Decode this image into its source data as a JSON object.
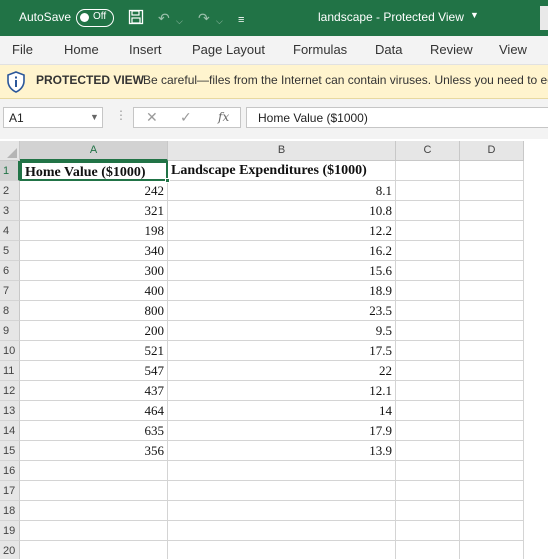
{
  "titlebar": {
    "autosave_label": "AutoSave",
    "autosave_state": "Off",
    "title": "landscape  -  Protected View",
    "colors": {
      "background": "#217346",
      "text": "#ffffff"
    }
  },
  "ribbon": {
    "tabs": [
      {
        "label": "File"
      },
      {
        "label": "Home"
      },
      {
        "label": "Insert"
      },
      {
        "label": "Page Layout"
      },
      {
        "label": "Formulas"
      },
      {
        "label": "Data"
      },
      {
        "label": "Review"
      },
      {
        "label": "View"
      }
    ]
  },
  "protected_view": {
    "label": "PROTECTED VIEW",
    "message": "Be careful—files from the Internet can contain viruses. Unless you need to ed",
    "icon": "shield-info-icon",
    "colors": {
      "background": "#fff4ce",
      "accent": "#2b579a"
    }
  },
  "formula_bar": {
    "name_box": "A1",
    "fx_label": "fx",
    "content": "Home Value ($1000)"
  },
  "grid": {
    "columns": [
      "A",
      "B",
      "C",
      "D"
    ],
    "selected_column": "A",
    "rows": [
      "1",
      "2",
      "3",
      "4",
      "5",
      "6",
      "7",
      "8",
      "9",
      "10",
      "11",
      "12",
      "13",
      "14",
      "15",
      "16",
      "17",
      "18",
      "19",
      "20"
    ],
    "active_cell": "A1",
    "header": [
      "Home Value ($1000)",
      "Landscape Expenditures ($1000)"
    ],
    "data": [
      [
        "242",
        "8.1"
      ],
      [
        "321",
        "10.8"
      ],
      [
        "198",
        "12.2"
      ],
      [
        "340",
        "16.2"
      ],
      [
        "300",
        "15.6"
      ],
      [
        "400",
        "18.9"
      ],
      [
        "800",
        "23.5"
      ],
      [
        "200",
        "9.5"
      ],
      [
        "521",
        "17.5"
      ],
      [
        "547",
        "22"
      ],
      [
        "437",
        "12.1"
      ],
      [
        "464",
        "14"
      ],
      [
        "635",
        "17.9"
      ],
      [
        "356",
        "13.9"
      ]
    ],
    "colors": {
      "selection": "#217346"
    }
  }
}
